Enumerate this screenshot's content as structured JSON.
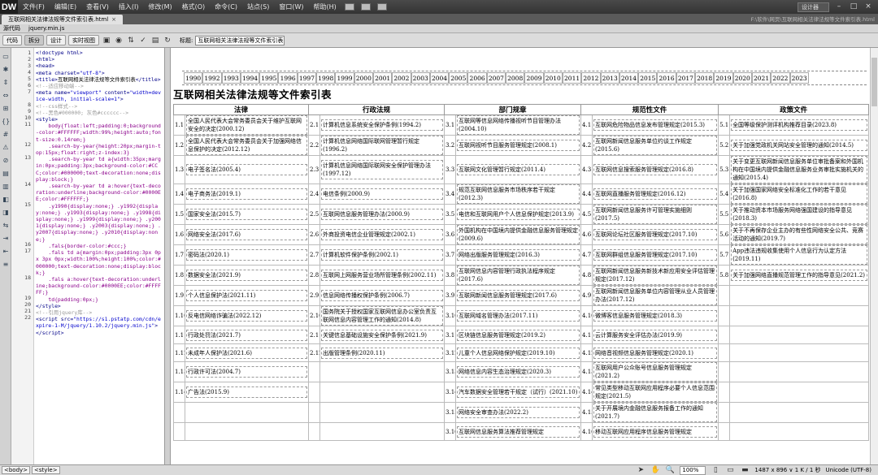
{
  "app": {
    "logo": "DW",
    "menus": [
      "文件(F)",
      "编辑(E)",
      "查看(V)",
      "插入(I)",
      "修改(M)",
      "格式(O)",
      "命令(C)",
      "站点(S)",
      "窗口(W)",
      "帮助(H)"
    ],
    "layout_label": "设计器"
  },
  "doc_tab": {
    "label": "互联网相关法律法规等文件索引表.html",
    "close": "×",
    "path": "F:\\软件\\网页\\互联网相关法律法规等文件索引表.html"
  },
  "related_files": {
    "source": "源代码",
    "file": "jquery.min.js"
  },
  "toolbar": {
    "code": "代码",
    "split": "拆分",
    "design": "设计",
    "live": "实时视图",
    "title_label": "标题:",
    "title_value": "互联网相关法律法规等文件索引表"
  },
  "code_view": {
    "lines": [
      {
        "n": "1",
        "html": "<span class='c-tag'>&lt;!doctype html&gt;</span>"
      },
      {
        "n": "2",
        "html": "<span class='c-tag'>&lt;html&gt;</span>"
      },
      {
        "n": "3",
        "html": "<span class='c-tag'>&lt;head&gt;</span>"
      },
      {
        "n": "4",
        "html": "<span class='c-tag'>&lt;meta charset=<span class='c-str'>\"utf-8\"</span>&gt;</span>"
      },
      {
        "n": "5",
        "html": "<span class='c-tag'>&lt;title&gt;</span>互联网相关法律法规等文件索引表<span class='c-tag'>&lt;/title&gt;</span>"
      },
      {
        "n": "6",
        "html": "<span class='c-com'>&lt;!--适应移动端--&gt;</span>"
      },
      {
        "n": "7",
        "html": "<span class='c-tag'>&lt;meta name=<span class='c-str'>\"viewport\"</span> content=<span class='c-str'>\"width=device-width, initial-scale=1\"</span>&gt;</span>"
      },
      {
        "n": "8",
        "html": "<span class='c-com'>&lt;!--css样式--&gt;</span>"
      },
      {
        "n": "9",
        "html": "<span class='c-com'>&lt;!--黑色#000000; 灰色#cccccc--&gt;</span>"
      },
      {
        "n": "10",
        "html": "<span class='c-tag'>&lt;style&gt;</span>"
      },
      {
        "n": "11",
        "html": "<span class='c-css'>    body{float:left;padding:0;background-color:#FFFFFF;width:99%;height:auto;font-size:0.14rem;}</span>"
      },
      {
        "n": "12",
        "html": "<span class='c-css'>    .search-by-year{height:20px;margin-top:15px;float:right;z-index:3}</span>"
      },
      {
        "n": "13",
        "html": "<span class='c-css'>    .search-by-year td a{width:35px;margin:0px;padding:3px;background-color:#CCC;color:#000000;text-decoration:none;display:block;}</span>"
      },
      {
        "n": "14",
        "html": "<span class='c-css'>    .search-by-year td a:hover{text-decoration:underline;background-color:#0000EE;color:#FFFFFF;}</span>"
      },
      {
        "n": "15",
        "html": "<span class='c-css'>    .y1990{display:none;} .y1992{display:none;} .y1993{display:none;} .y1998{display:none;} .y1999{display:none;} .y2001{display:none;} .y2003{display:none;} .y2007{display:none;} .y2010{display:none;}</span>"
      },
      {
        "n": "16",
        "html": "<span class='c-css'>    .fals{border-color:#ccc;}</span>"
      },
      {
        "n": "17",
        "html": "<span class='c-css'>    .fals td a{margin:0px;padding:3px 0px 3px 0px;width:100%;height:100%;color:#000000;text-decoration:none;display:block;}</span>"
      },
      {
        "n": "18",
        "html": "<span class='c-css'>    .fals a:hover{text-decoration:underline;background-color:#0000EE;color:#FFFFFF;}</span>"
      },
      {
        "n": "19",
        "html": "<span class='c-css'>    td{padding:0px;}</span>"
      },
      {
        "n": "20",
        "html": "<span class='c-tag'>&lt;/style&gt;</span>"
      },
      {
        "n": "21",
        "html": "<span class='c-com'>&lt;!--引用jquery库--&gt;</span>"
      },
      {
        "n": "22",
        "html": "<span class='c-tag'>&lt;script src=<span class='c-str'>\"https://s1.pstatp.com/cdn/expire-1-M/jquery/1.10.2/jquery.min.js\"</span>&gt;&lt;/script&gt;</span>"
      }
    ]
  },
  "years": [
    "1990",
    "1992",
    "1993",
    "1994",
    "1995",
    "1996",
    "1997",
    "1998",
    "1999",
    "2000",
    "2001",
    "2002",
    "2003",
    "2004",
    "2005",
    "2006",
    "2007",
    "2008",
    "2009",
    "2010",
    "2011",
    "2012",
    "2013",
    "2014",
    "2015",
    "2016",
    "2017",
    "2018",
    "2019",
    "2020",
    "2021",
    "2022",
    "2023"
  ],
  "page_title": "互联网相关法律法规等文件索引表",
  "columns": [
    "法律",
    "行政法规",
    "部门规章",
    "规范性文件",
    "政策文件"
  ],
  "rows": [
    [
      "1.1",
      "全国人民代表大会常务委员会关于维护互联网安全的决定(2000.12)",
      "2.1",
      "计算机信息系统安全保护条例(1994.2)",
      "3.1",
      "互联网等信息网络传播视听节目管理办法(2004.10)",
      "4.1",
      "互联网危险物品信息发布管理规定(2015.3)",
      "5.1",
      "全国等级保护测评机构推荐目录(2023.8)"
    ],
    [
      "1.2",
      "全国人民代表大会常务委员会关于加强网络信息保护的决定(2012.12)",
      "2.2",
      "计算机信息网络国际联网管理暂行规定(1996.2)",
      "3.2",
      "互联网视听节目服务管理规定(2008.1)",
      "4.2",
      "互联网新闻信息服务单位约谈工作规定(2015.6)",
      "5.2",
      "关于加强党政机关网站安全管理的通知(2014.5)"
    ],
    [
      "1.3",
      "电子签名法(2005.4)",
      "2.3",
      "计算机信息网络国际联网安全保护管理办法(1997.12)",
      "3.3",
      "互联网文化管理暂行规定(2011.4)",
      "4.3",
      "互联网信息搜索服务管理规定(2016.8)",
      "5.3",
      "关于变更互联网新闻信息服务单位审批备案和外国机构在中国境内提供金融信息服务业务审批实施机关的通知(2015.4)"
    ],
    [
      "1.4",
      "电子商务法(2019.1)",
      "2.4",
      "电信条例(2000.9)",
      "3.4",
      "规范互联网信息服务市场秩序若干规定(2012.3)",
      "4.4",
      "互联网直播服务管理规定(2016.12)",
      "5.4",
      "关于加强国家网络安全标准化工作的若干意见(2016.8)"
    ],
    [
      "1.5",
      "国家安全法(2015.7)",
      "2.5",
      "互联网信息服务管理办法(2000.9)",
      "3.5",
      "电信和互联网用户个人信息保护规定(2013.9)",
      "4.5",
      "互联网新闻信息服务许可管理实施细则(2017.5)",
      "5.5",
      "关于推动资本市场服务网络强国建设的指导意见(2018.3)"
    ],
    [
      "1.6",
      "网络安全法(2017.6)",
      "2.6",
      "外商投资电信企业管理规定(2002.1)",
      "3.6",
      "外国机构在中国境内提供金融信息服务管理规定(2009.6)",
      "4.6",
      "互联网论坛社区服务管理规定(2017.10)",
      "5.6",
      "关于不再保存企业主办的有些性网络安全公共、竞赛活动的通知(2019.7)"
    ],
    [
      "1.7",
      "密码法(2020.1)",
      "2.7",
      "计算机软件保护条例(2002.1)",
      "3.7",
      "网络出版服务管理规定(2016.3)",
      "4.7",
      "互联网群组信息服务管理规定(2017.10)",
      "5.7",
      "App违法违规收集使用个人信息行为认定方法(2019.11)"
    ],
    [
      "1.8",
      "数据安全法(2021.9)",
      "2.8",
      "互联网上网服务营业场所管理条例(2002.11)",
      "3.8",
      "互联网信息内容管理行政执法程序规定(2017.6)",
      "4.8",
      "互联网新闻信息服务新技术新应用安全评估管理规定(2017.12)",
      "5.8",
      "关于加强网络直播规范管理工作的指导意见(2021.2)"
    ],
    [
      "1.9",
      "个人信息保护法(2021.11)",
      "2.9",
      "信息网络传播权保护条例(2006.7)",
      "3.9",
      "互联网新闻信息服务管理规定(2017.6)",
      "4.9",
      "互联网新闻信息服务单位内容管理从业人员管理办法(2017.12)",
      "",
      ""
    ],
    [
      "1.10",
      "反电信网络诈骗法(2022.12)",
      "2.10",
      "国务院关于授权国家互联网信息办公室负责互联网信息内容管理工作的通知(2014.8)",
      "3.10",
      "互联网域名管理办法(2017.11)",
      "4.10",
      "微博客信息服务管理规定(2018.3)",
      "",
      ""
    ],
    [
      "1.11",
      "行政处罚法(2021.7)",
      "2.11",
      "关键信息基础设施安全保护条例(2021.9)",
      "3.11",
      "区块链信息服务管理规定(2019.2)",
      "4.11",
      "云计算服务安全评估办法(2019.9)",
      "",
      ""
    ],
    [
      "1.12",
      "未成年人保护法(2021.6)",
      "2.12",
      "出版管理条例(2020.11)",
      "3.12",
      "儿童个人信息网络保护规定(2019.10)",
      "4.12",
      "网络音视频信息服务管理规定(2020.1)",
      "",
      ""
    ],
    [
      "1.13",
      "行政许可法(2004.7)",
      "",
      "",
      "3.13",
      "网络信息内容生态治理规定(2020.3)",
      "4.13",
      "互联网用户公众账号信息服务管理规定(2021.2)",
      "",
      ""
    ],
    [
      "1.14",
      "广告法(2015.9)",
      "",
      "",
      "3.14",
      "汽车数据安全管理若干规定（试行）(2021.10)",
      "4.14",
      "常见类型移动互联网应用程序必要个人信息范围规定(2021.5)",
      "",
      ""
    ],
    [
      "",
      "",
      "",
      "",
      "3.15",
      "网络安全审查办法(2022.2)",
      "4.15",
      "关于开展境内金融信息服务报备工作的通知(2021.7)",
      "",
      ""
    ],
    [
      "",
      "",
      "",
      "",
      "3.16",
      "互联网信息服务算法推荐管理规定",
      "4.16",
      "移动互联网应用程序信息服务管理规定",
      "",
      ""
    ]
  ],
  "statusbar": {
    "tags": [
      "<body>",
      "<style>"
    ],
    "zoom": "100%",
    "dimensions": "1487 x 896 ∨ 1 K / 1 秒",
    "encoding": "Unicode (UTF-8)"
  }
}
